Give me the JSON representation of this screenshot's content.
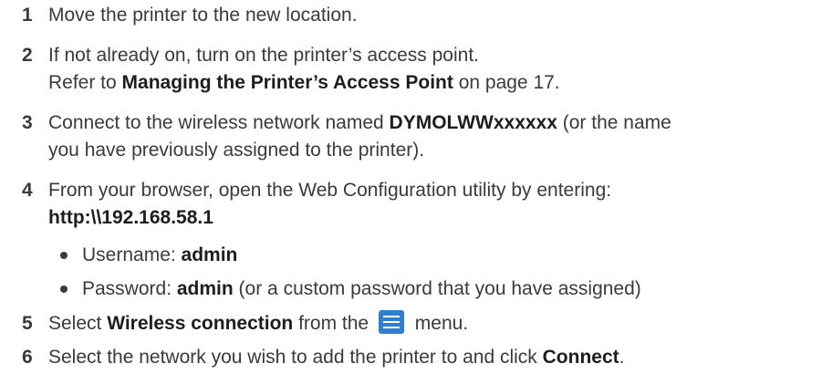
{
  "steps": [
    {
      "num": "1",
      "text": "Move the printer to the new location."
    },
    {
      "num": "2",
      "line1": "If not already on, turn on the printer’s access point.",
      "line2_pre": "Refer to ",
      "line2_bold": "Managing the Printer’s Access Point",
      "line2_post": " on page 17."
    },
    {
      "num": "3",
      "line1_pre": "Connect to the wireless network named ",
      "line1_bold": "DYMOLWWxxxxxx",
      "line1_post": " (or the name",
      "line2": "you have previously assigned to the printer)."
    },
    {
      "num": "4",
      "line1": "From your browser, open the Web Configuration utility by entering:",
      "url": "http:\\\\192.168.58.1"
    },
    {
      "num": "5",
      "pre": "Select ",
      "bold": "Wireless connection",
      "mid": " from the ",
      "post": " menu."
    },
    {
      "num": "6",
      "pre": "Select the network you wish to add the printer to and click ",
      "bold": "Connect",
      "post": "."
    }
  ],
  "bullets": [
    {
      "pre": "Username: ",
      "bold": "admin",
      "post": ""
    },
    {
      "pre": "Password: ",
      "bold": "admin",
      "post": " (or a custom password that you have assigned)"
    }
  ],
  "menu_icon": {
    "name": "menu-icon",
    "color": "#2f7fd1"
  }
}
